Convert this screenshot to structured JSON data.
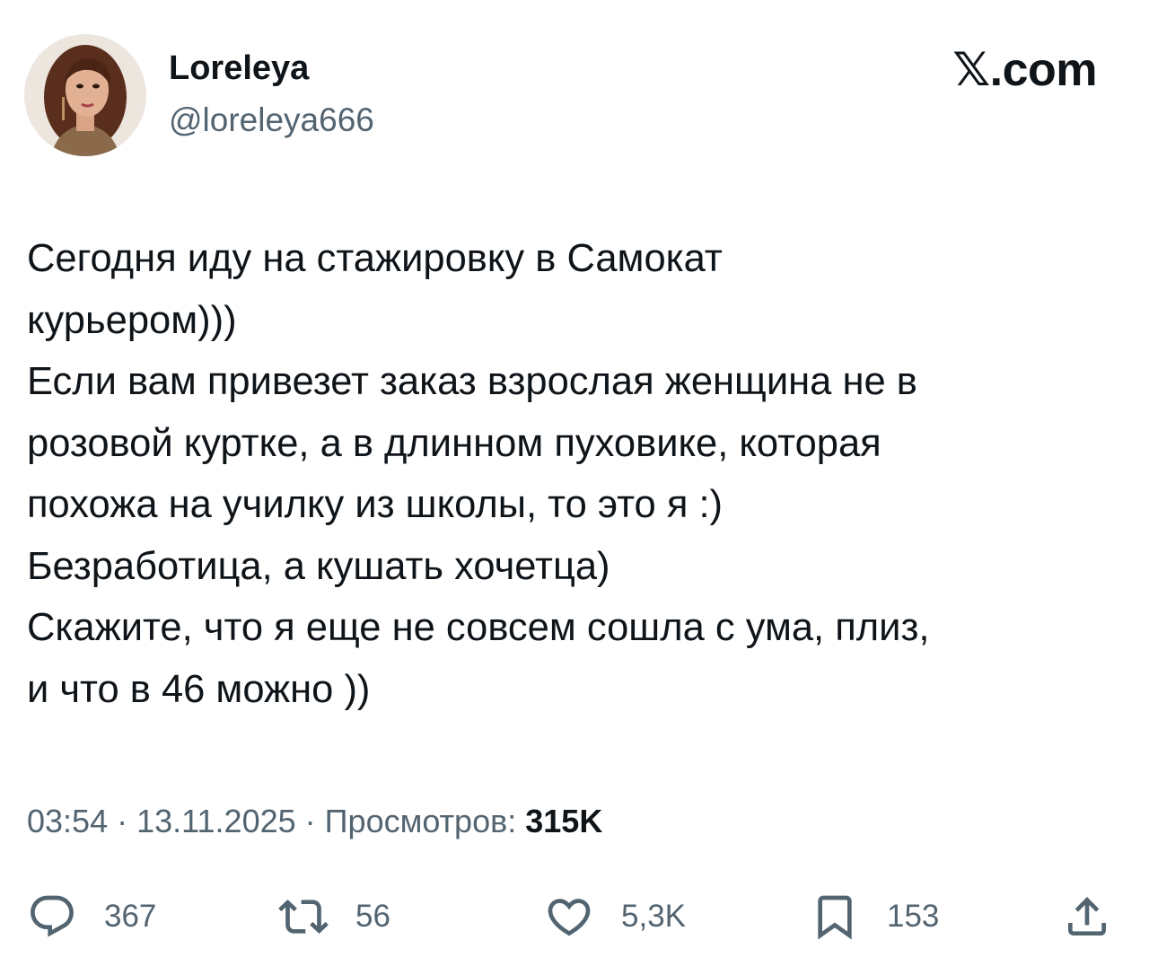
{
  "author": {
    "display_name": "Loreleya",
    "handle": "@loreleya666"
  },
  "brand": {
    "logo_text": "𝕏.com"
  },
  "tweet": {
    "lines": [
      "Сегодня иду на стажировку в Самокат",
      "курьером)))",
      "Если вам привезет заказ взрослая женщина не в",
      "розовой куртке, а в длинном пуховике, которая",
      "похожа на училку из школы, то это я :)",
      "Безработица, а кушать хочетца)",
      "Скажите, что я еще не совсем сошла с ума, плиз,",
      "и что в 46 можно ))"
    ]
  },
  "meta": {
    "time": "03:54",
    "separator": "·",
    "date": "13.11.2025",
    "views_label": "Просмотров:",
    "views_count": "315K"
  },
  "actions": {
    "reply": {
      "icon": "reply-icon",
      "count": "367"
    },
    "retweet": {
      "icon": "retweet-icon",
      "count": "56"
    },
    "like": {
      "icon": "heart-icon",
      "count": "5,3K"
    },
    "bookmark": {
      "icon": "bookmark-icon",
      "count": "153"
    },
    "share": {
      "icon": "share-icon"
    }
  },
  "colors": {
    "text_primary": "#0f1419",
    "text_secondary": "#536471",
    "background": "#ffffff"
  }
}
